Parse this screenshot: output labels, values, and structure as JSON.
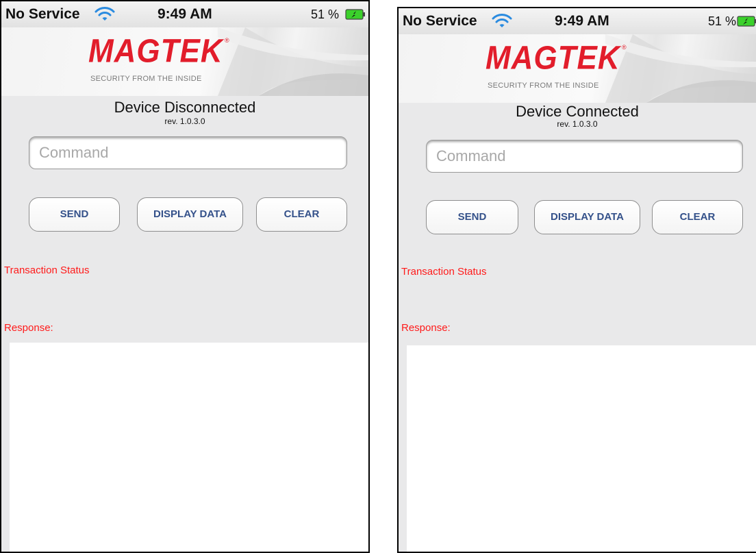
{
  "screens": [
    {
      "status_bar": {
        "carrier": "No Service",
        "time": "9:49 AM",
        "battery": "51 %"
      },
      "banner": {
        "logo": "MAGTEK",
        "tagline": "SECURITY FROM THE INSIDE"
      },
      "device_status": "Device Disconnected",
      "revision": "rev. 1.0.3.0",
      "command": {
        "placeholder": "Command",
        "value": ""
      },
      "buttons": {
        "send": "SEND",
        "display_data": "DISPLAY DATA",
        "clear": "CLEAR"
      },
      "transaction_status_label": "Transaction Status",
      "response_label": "Response:",
      "response_text": ""
    },
    {
      "status_bar": {
        "carrier": "No Service",
        "time": "9:49 AM",
        "battery": "51 %"
      },
      "banner": {
        "logo": "MAGTEK",
        "tagline": "SECURITY FROM THE INSIDE"
      },
      "device_status": "Device Connected",
      "revision": "rev. 1.0.3.0",
      "command": {
        "placeholder": "Command",
        "value": ""
      },
      "buttons": {
        "send": "SEND",
        "display_data": "DISPLAY DATA",
        "clear": "CLEAR"
      },
      "transaction_status_label": "Transaction Status",
      "response_label": "Response:",
      "response_text": ""
    }
  ],
  "icons": {
    "wifi": "wifi-icon",
    "battery": "battery-charging-icon"
  },
  "colors": {
    "brand_red": "#e21d2b",
    "label_red": "#ff1a1a",
    "button_text": "#34518a",
    "battery_green": "#3bd12b"
  }
}
